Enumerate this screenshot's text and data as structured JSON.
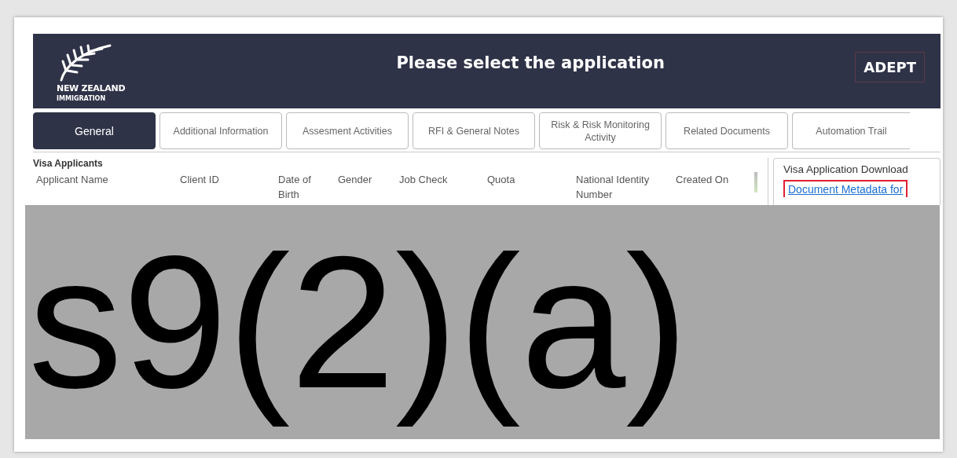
{
  "header": {
    "logo_lines": [
      "NEW ZEALAND",
      "IMMIGRATION"
    ],
    "title": "Please select the application",
    "badge": "ADEPT"
  },
  "tabs": [
    {
      "label": "General",
      "selected": true
    },
    {
      "label": "Additional Information",
      "selected": false
    },
    {
      "label": "Assesment Activities",
      "selected": false
    },
    {
      "label": "RFI & General Notes",
      "selected": false
    },
    {
      "label": "Risk & Risk Monitoring Activity",
      "selected": false
    },
    {
      "label": "Related Documents",
      "selected": false
    },
    {
      "label": "Automation Trail",
      "selected": false
    }
  ],
  "applicants": {
    "title": "Visa Applicants",
    "columns": [
      "Applicant Name",
      "Client ID",
      "Date of Birth",
      "Gender",
      "Job Check",
      "Quota",
      "National Identity Number",
      "Created On"
    ]
  },
  "download_panel": {
    "title": "Visa Application Download",
    "link": "Document Metadata for"
  },
  "redaction": {
    "label": "s9(2)(a)"
  }
}
